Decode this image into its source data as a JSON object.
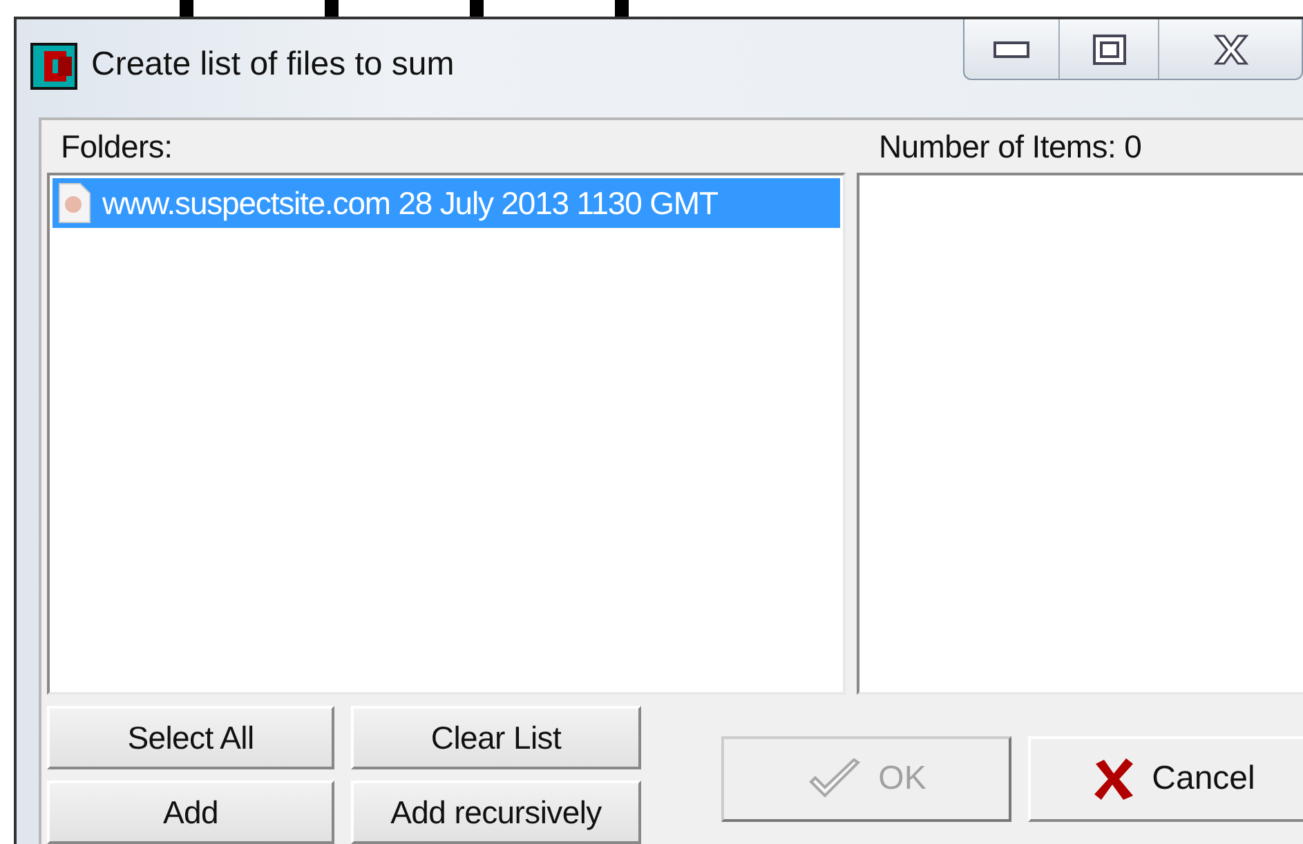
{
  "window": {
    "title": "Create list of files to sum"
  },
  "folders": {
    "label": "Folders:",
    "items": [
      {
        "label": "www.suspectsite.com 28 July 2013 1130 GMT",
        "selected": true
      }
    ]
  },
  "items": {
    "label": "Number of Items: 0"
  },
  "list_buttons": [
    {
      "label": "Select All"
    },
    {
      "label": "Clear List"
    },
    {
      "label": "Add"
    },
    {
      "label": "Add recursively"
    }
  ],
  "dialog_buttons": [
    {
      "label": "OK",
      "kind": "ok",
      "disabled": true
    },
    {
      "label": "Cancel",
      "kind": "cancel",
      "disabled": false
    }
  ]
}
